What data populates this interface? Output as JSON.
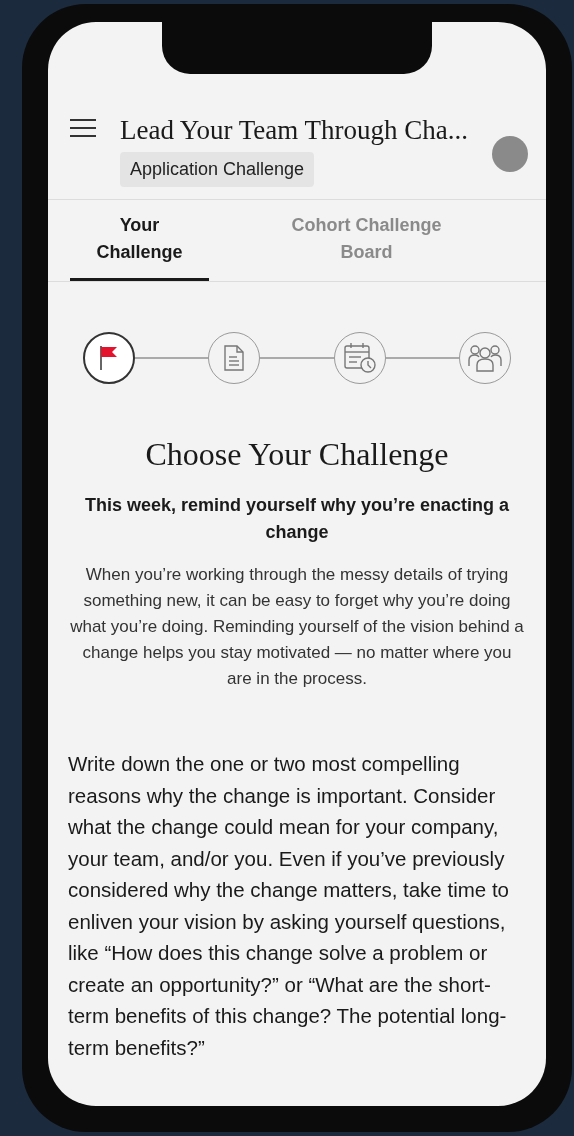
{
  "header": {
    "title": "Lead Your Team Through Cha...",
    "badge": "Application Challenge"
  },
  "tabs": [
    {
      "label": "Your Challenge",
      "selected": true
    },
    {
      "label": "Cohort Challenge Board",
      "selected": false
    }
  ],
  "steps": [
    {
      "kind": "flag",
      "selected": true
    },
    {
      "kind": "document",
      "selected": false
    },
    {
      "kind": "calendar",
      "selected": false
    },
    {
      "kind": "group",
      "selected": false
    }
  ],
  "heading": "Choose Your Challenge",
  "subheading": "This week, remind yourself why you’re enacting a change",
  "intro": "When you’re working through the messy details of trying something new, it can be easy to forget why you’re doing what you’re doing. Reminding yourself of the vision behind a change helps you stay motivated — no matter where you are in the process.",
  "prompt": "Write down the one or two most compelling reasons why the change is important. Consider what the change could mean for your company, your team, and/or you. Even if you’ve previously considered why the change matters, take time to enliven your vision by asking yourself questions, like “How does this change solve a problem or create an opportunity?” or “What are the short-term benefits of this change? The potential long-term benefits?”"
}
